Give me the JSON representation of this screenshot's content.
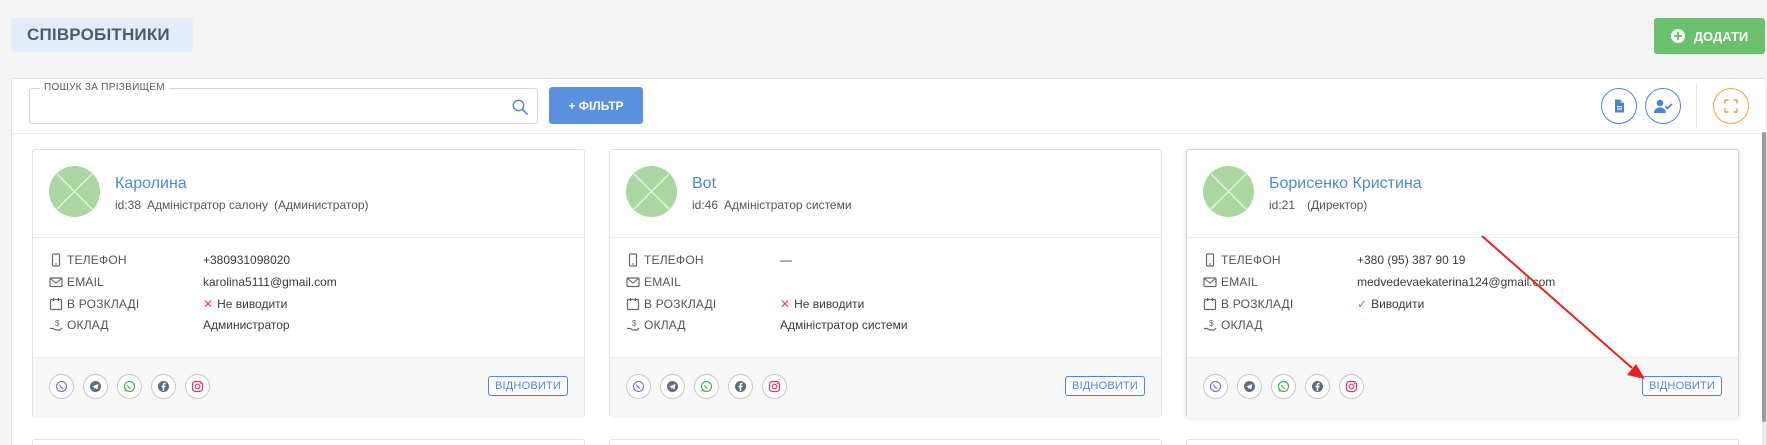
{
  "header": {
    "title": "СПІВРОБІТНИКИ",
    "add_label": "ДОДАТИ"
  },
  "toolbar": {
    "search_label": "ПОШУК ЗА ПРІЗВИЩЕМ",
    "search_value": "",
    "filter_label": "+ ФІЛЬТР"
  },
  "colors": {
    "accent": "#4b88d9",
    "add_button": "#6ac06b",
    "filter_button": "#5b8fe0",
    "negative": "#e44b4b",
    "positive": "#4caf50",
    "annotation_arrow": "#e8231f"
  },
  "labels": {
    "phone": "ТЕЛЕФОН",
    "email": "EMAIL",
    "schedule": "В РОЗКЛАДІ",
    "salary": "ОКЛАД",
    "restore": "ВІДНОВИТИ"
  },
  "employees": [
    {
      "name": "Каролина",
      "id": "id:38",
      "position": "Адміністратор салону",
      "role": "(Администратор)",
      "phone": "+380931098020",
      "email": "karolina5111@gmail.com",
      "schedule": "Не виводити",
      "schedule_on": false,
      "salary": "Администратор"
    },
    {
      "name": "Bot",
      "id": "id:46",
      "position": "Адміністратор системи",
      "role": "",
      "phone": "—",
      "email": "",
      "schedule": "Не виводити",
      "schedule_on": false,
      "salary": "Адміністратор системи"
    },
    {
      "name": "Борисенко Кристина",
      "id": "id:21",
      "position": "",
      "role": "(Директор)",
      "phone": "+380 (95) 387 90 19",
      "email": "medvedevaekaterina124@gmail.com",
      "schedule": "Виводити",
      "schedule_on": true,
      "salary": ""
    }
  ],
  "social_icons": [
    "viber-icon",
    "telegram-icon",
    "whatsapp-icon",
    "facebook-icon",
    "instagram-icon"
  ]
}
